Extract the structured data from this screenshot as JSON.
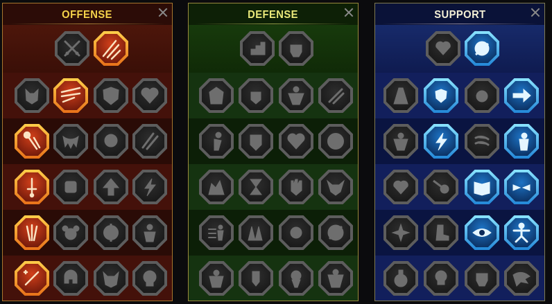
{
  "panels": {
    "offense": {
      "title": "OFFENSE"
    },
    "defense": {
      "title": "DEFENSE"
    },
    "support": {
      "title": "SUPPORT"
    }
  },
  "colors": {
    "offense_accent": "#f5d24a",
    "defense_accent": "#eae97a",
    "support_accent": "#f3efd6",
    "active_orange": "#e8711a",
    "active_blue": "#2387d8",
    "locked_gray": "#5d5d5d"
  },
  "mastery_state": {
    "offense": {
      "top": [
        "locked",
        "active"
      ],
      "rows": [
        [
          "locked",
          "active",
          "locked",
          "locked"
        ],
        [
          "active",
          "locked",
          "locked",
          "locked"
        ],
        [
          "active",
          "locked",
          "locked",
          "locked"
        ],
        [
          "active",
          "locked",
          "locked",
          "locked"
        ],
        [
          "active",
          "locked",
          "locked",
          "locked"
        ]
      ]
    },
    "defense": {
      "top": [
        "locked",
        "locked"
      ],
      "rows": [
        [
          "locked",
          "locked",
          "locked",
          "locked"
        ],
        [
          "locked",
          "locked",
          "locked",
          "locked"
        ],
        [
          "locked",
          "locked",
          "locked",
          "locked"
        ],
        [
          "locked",
          "locked",
          "locked",
          "locked"
        ],
        [
          "locked",
          "locked",
          "locked",
          "locked"
        ]
      ]
    },
    "support": {
      "top": [
        "locked",
        "active"
      ],
      "rows": [
        [
          "locked",
          "active",
          "locked",
          "active"
        ],
        [
          "locked",
          "active",
          "locked",
          "active"
        ],
        [
          "locked",
          "locked",
          "active",
          "active"
        ],
        [
          "locked",
          "locked",
          "active",
          "active"
        ],
        [
          "locked",
          "locked",
          "locked",
          "locked"
        ]
      ]
    }
  }
}
